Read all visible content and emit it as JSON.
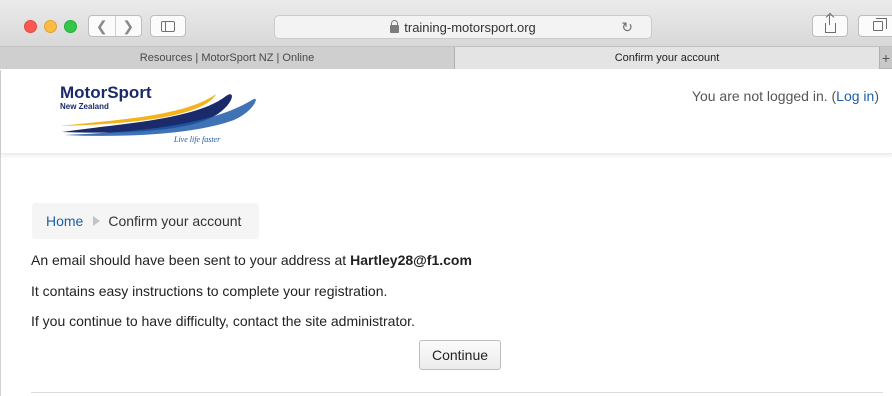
{
  "browser": {
    "url": "training-motorsport.org",
    "tabs": [
      {
        "label": "Resources | MotorSport NZ | Online",
        "active": false
      },
      {
        "label": "Confirm your account",
        "active": true
      }
    ],
    "new_tab_label": "+",
    "icons": {
      "back": "chevron-left-icon",
      "forward": "chevron-right-icon",
      "sidebar": "sidebar-icon",
      "lock": "lock-icon",
      "reload": "reload-icon",
      "share": "share-icon",
      "tabs": "tabs-overview-icon"
    }
  },
  "header": {
    "logo": {
      "brand": "MotorSport",
      "sub": "New Zealand",
      "tagline": "Live life faster",
      "colors": {
        "navy": "#1b2a6b",
        "gold": "#f5b21b",
        "blue": "#1f5aa8"
      }
    },
    "login_text": "You are not logged in. (",
    "login_link": "Log in",
    "login_suffix": ")"
  },
  "breadcrumb": {
    "home": "Home",
    "current": "Confirm your account"
  },
  "message": {
    "line1_prefix": "An email should have been sent to your address at ",
    "email": "Hartley28@f1.com",
    "line2": "It contains easy instructions to complete your registration.",
    "line3": "If you continue to have difficulty, contact the site administrator."
  },
  "actions": {
    "continue_label": "Continue"
  },
  "colors": {
    "link": "#1d5fa8",
    "text": "#222222"
  }
}
